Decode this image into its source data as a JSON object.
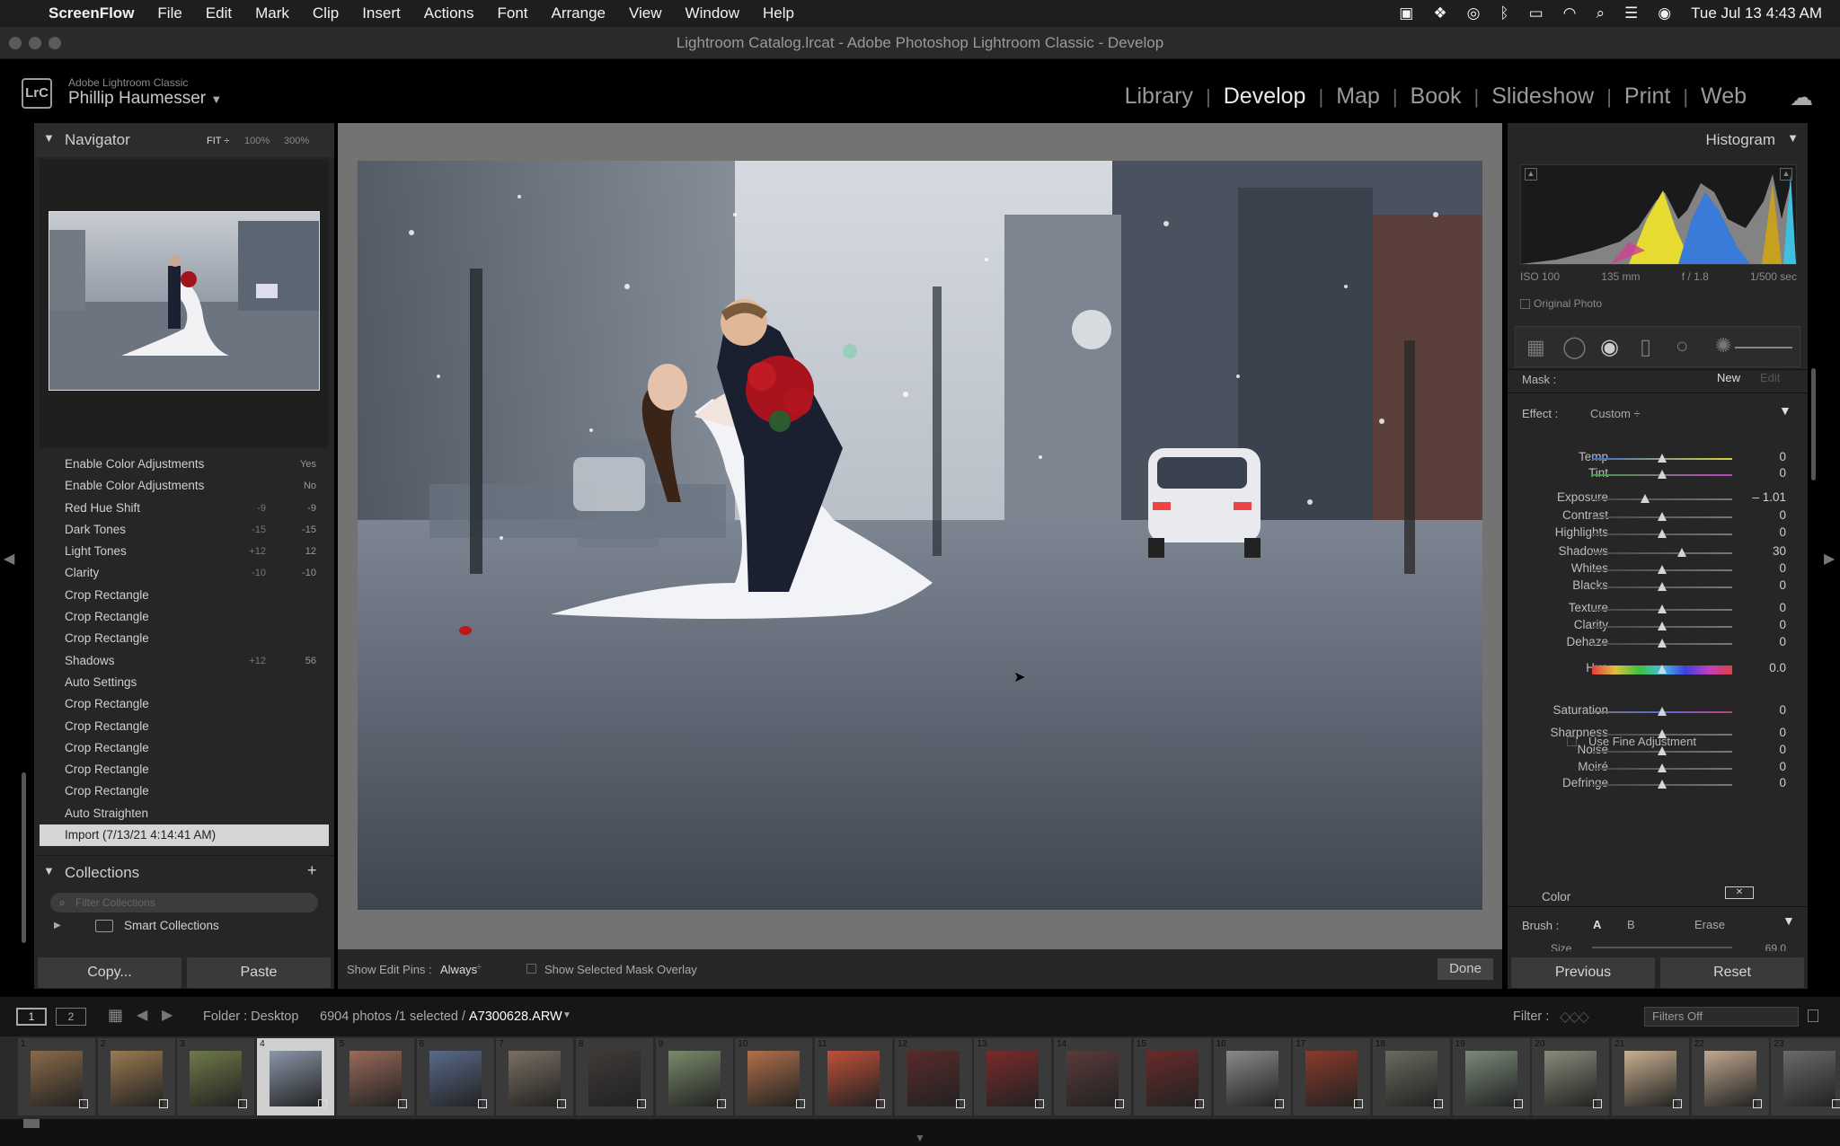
{
  "menubar": {
    "app": "ScreenFlow",
    "items": [
      "File",
      "Edit",
      "Mark",
      "Clip",
      "Insert",
      "Actions",
      "Font",
      "Arrange",
      "View",
      "Window",
      "Help"
    ],
    "datetime": "Tue Jul 13  4:43 AM"
  },
  "window": {
    "title": "Lightroom Catalog.lrcat - Adobe Photoshop Lightroom Classic - Develop"
  },
  "header": {
    "logo": "LrC",
    "product": "Adobe Lightroom Classic",
    "user": "Phillip Haumesser",
    "modules": [
      "Library",
      "Develop",
      "Map",
      "Book",
      "Slideshow",
      "Print",
      "Web"
    ],
    "active_module": "Develop"
  },
  "navigator": {
    "title": "Navigator",
    "zoom_options": [
      "FIT ÷",
      "100%",
      "300%"
    ]
  },
  "history": [
    {
      "label": "Enable Color Adjustments",
      "before": "",
      "after": "Yes"
    },
    {
      "label": "Enable Color Adjustments",
      "before": "",
      "after": "No"
    },
    {
      "label": "Red Hue Shift",
      "before": "-9",
      "after": "-9"
    },
    {
      "label": "Dark Tones",
      "before": "-15",
      "after": "-15"
    },
    {
      "label": "Light Tones",
      "before": "+12",
      "after": "12"
    },
    {
      "label": "Clarity",
      "before": "-10",
      "after": "-10"
    },
    {
      "label": "Crop Rectangle",
      "before": "",
      "after": ""
    },
    {
      "label": "Crop Rectangle",
      "before": "",
      "after": ""
    },
    {
      "label": "Crop Rectangle",
      "before": "",
      "after": ""
    },
    {
      "label": "Shadows",
      "before": "+12",
      "after": "56"
    },
    {
      "label": "Auto Settings",
      "before": "",
      "after": ""
    },
    {
      "label": "Crop Rectangle",
      "before": "",
      "after": ""
    },
    {
      "label": "Crop Rectangle",
      "before": "",
      "after": ""
    },
    {
      "label": "Crop Rectangle",
      "before": "",
      "after": ""
    },
    {
      "label": "Crop Rectangle",
      "before": "",
      "after": ""
    },
    {
      "label": "Crop Rectangle",
      "before": "",
      "after": ""
    },
    {
      "label": "Auto Straighten",
      "before": "",
      "after": ""
    },
    {
      "label": "Import (7/13/21 4:14:41 AM)",
      "before": "",
      "after": ""
    }
  ],
  "collections": {
    "title": "Collections",
    "filter_placeholder": "Filter Collections",
    "smart": "Smart Collections"
  },
  "left_buttons": {
    "copy": "Copy...",
    "paste": "Paste"
  },
  "toolbar": {
    "show_pins_label": "Show Edit Pins :",
    "show_pins_value": "Always",
    "mask_overlay": "Show Selected Mask Overlay",
    "done": "Done"
  },
  "histogram": {
    "title": "Histogram",
    "iso": "ISO 100",
    "focal": "135 mm",
    "aperture": "f / 1.8",
    "shutter": "1/500 sec",
    "original_photo": "Original Photo"
  },
  "mask": {
    "label": "Mask :",
    "new": "New",
    "edit": "Edit"
  },
  "effect": {
    "label": "Effect :",
    "value": "Custom ÷"
  },
  "sliders": [
    {
      "label": "Temp",
      "value": "0",
      "pos": 0.5,
      "track": "temp"
    },
    {
      "label": "Tint",
      "value": "0",
      "pos": 0.5,
      "track": "tint"
    },
    {
      "label": "Exposure",
      "value": "– 1.01",
      "pos": 0.38,
      "track": "gray"
    },
    {
      "label": "Contrast",
      "value": "0",
      "pos": 0.5,
      "track": "gray"
    },
    {
      "label": "Highlights",
      "value": "0",
      "pos": 0.5,
      "track": "gray"
    },
    {
      "label": "Shadows",
      "value": "30",
      "pos": 0.64,
      "track": "gray"
    },
    {
      "label": "Whites",
      "value": "0",
      "pos": 0.5,
      "track": "gray"
    },
    {
      "label": "Blacks",
      "value": "0",
      "pos": 0.5,
      "track": "gray"
    },
    {
      "label": "Texture",
      "value": "0",
      "pos": 0.5,
      "track": "gray"
    },
    {
      "label": "Clarity",
      "value": "0",
      "pos": 0.5,
      "track": "gray"
    },
    {
      "label": "Dehaze",
      "value": "0",
      "pos": 0.5,
      "track": "gray"
    },
    {
      "label": "Hue",
      "value": "0.0",
      "pos": 0.5,
      "track": "hue"
    },
    {
      "label": "Saturation",
      "value": "0",
      "pos": 0.5,
      "track": "sat"
    },
    {
      "label": "Sharpness",
      "value": "0",
      "pos": 0.5,
      "track": "gray"
    },
    {
      "label": "Noise",
      "value": "0",
      "pos": 0.5,
      "track": "gray"
    },
    {
      "label": "Moiré",
      "value": "0",
      "pos": 0.5,
      "track": "gray"
    },
    {
      "label": "Defringe",
      "value": "0",
      "pos": 0.5,
      "track": "gray"
    }
  ],
  "fine_adjust": "Use Fine Adjustment",
  "color_label": "Color",
  "brush": {
    "label": "Brush :",
    "a": "A",
    "b": "B",
    "erase": "Erase",
    "size": "Size",
    "size_val": "69.0"
  },
  "right_buttons": {
    "previous": "Previous",
    "reset": "Reset"
  },
  "filmbar": {
    "view1": "1",
    "view2": "2",
    "folder": "Folder : Desktop",
    "count": "6904 photos /1 selected /",
    "file": "A7300628.ARW",
    "filter_label": "Filter :",
    "filter_value": "Filters Off"
  },
  "filmstrip": {
    "numbers": [
      "1",
      "2",
      "3",
      "4",
      "5",
      "6",
      "7",
      "8",
      "9",
      "10",
      "11",
      "12",
      "13",
      "14",
      "15",
      "16",
      "17",
      "18",
      "19",
      "20",
      "21",
      "22",
      "23"
    ],
    "selected_index": 3,
    "colors": [
      "#8a6a4a",
      "#9a7a50",
      "#6f7a4a",
      "#8a96a8",
      "#9a6a5a",
      "#5a6a8a",
      "#7a6f62",
      "#3e3a38",
      "#7a8a6a",
      "#b0704a",
      "#c0503a",
      "#5a2a2a",
      "#7a2a2a",
      "#5a3a3a",
      "#6a2a2a",
      "#8a8a8a",
      "#8a3a2a",
      "#6a6a60",
      "#7a8a7a",
      "#8a8a7a",
      "#c8b090",
      "#c0a890",
      "#6a6a6a"
    ]
  }
}
